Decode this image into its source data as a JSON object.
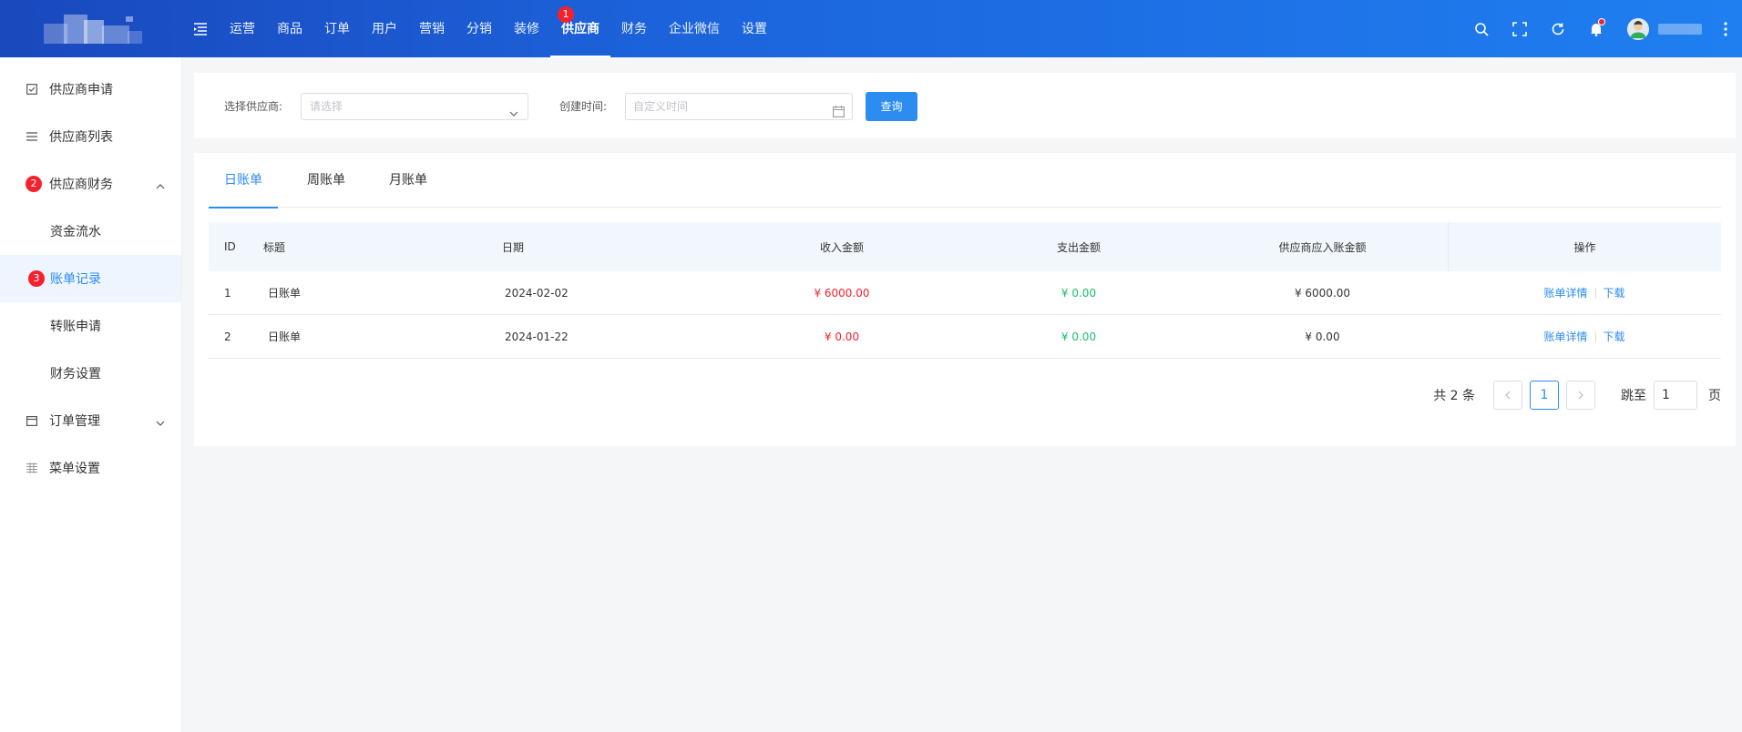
{
  "header": {
    "nav": [
      {
        "label": "运营"
      },
      {
        "label": "商品"
      },
      {
        "label": "订单"
      },
      {
        "label": "用户"
      },
      {
        "label": "营销"
      },
      {
        "label": "分销"
      },
      {
        "label": "装修"
      },
      {
        "label": "供应商",
        "active": true,
        "badge": "1"
      },
      {
        "label": "财务"
      },
      {
        "label": "企业微信"
      },
      {
        "label": "设置"
      }
    ],
    "icons": [
      "search-icon",
      "fullscreen-icon",
      "refresh-icon",
      "bell-icon",
      "avatar",
      "more-icon"
    ]
  },
  "sidebar": {
    "items": [
      {
        "label": "供应商申请",
        "icon": "checkbox-icon"
      },
      {
        "label": "供应商列表",
        "icon": "list-icon"
      },
      {
        "label": "供应商财务",
        "badge": "2",
        "expanded": true
      },
      {
        "label": "资金流水"
      },
      {
        "label": "账单记录",
        "badge": "3",
        "active": true
      },
      {
        "label": "转账申请"
      },
      {
        "label": "财务设置"
      },
      {
        "label": "订单管理",
        "icon": "window-icon"
      },
      {
        "label": "菜单设置",
        "icon": "grid-icon"
      }
    ]
  },
  "filter": {
    "supplier_label": "选择供应商:",
    "supplier_placeholder": "请选择",
    "time_label": "创建时间:",
    "time_placeholder": "自定义时间",
    "query_button": "查询"
  },
  "tabs": [
    {
      "label": "日账单",
      "active": true
    },
    {
      "label": "周账单"
    },
    {
      "label": "月账单"
    }
  ],
  "table": {
    "columns": [
      "ID",
      "标题",
      "日期",
      "收入金额",
      "支出金额",
      "供应商应入账金额",
      "操作"
    ],
    "rows": [
      {
        "id": "1",
        "title": "日账单",
        "date": "2024-02-02",
        "income": "¥ 6000.00",
        "expense": "¥ 0.00",
        "supplier_amount": "¥ 6000.00",
        "detail": "账单详情",
        "download": "下载"
      },
      {
        "id": "2",
        "title": "日账单",
        "date": "2024-01-22",
        "income": "¥ 0.00",
        "expense": "¥ 0.00",
        "supplier_amount": "¥ 0.00",
        "detail": "账单详情",
        "download": "下载"
      }
    ]
  },
  "pagination": {
    "total": "共 2 条",
    "current": "1",
    "jump_label": "跳至",
    "jump_value": "1",
    "page_unit": "页"
  },
  "colors": {
    "primary": "#2d8cf0",
    "income": "#f5222d",
    "expense": "#19be6b",
    "badge": "#f5222d"
  }
}
